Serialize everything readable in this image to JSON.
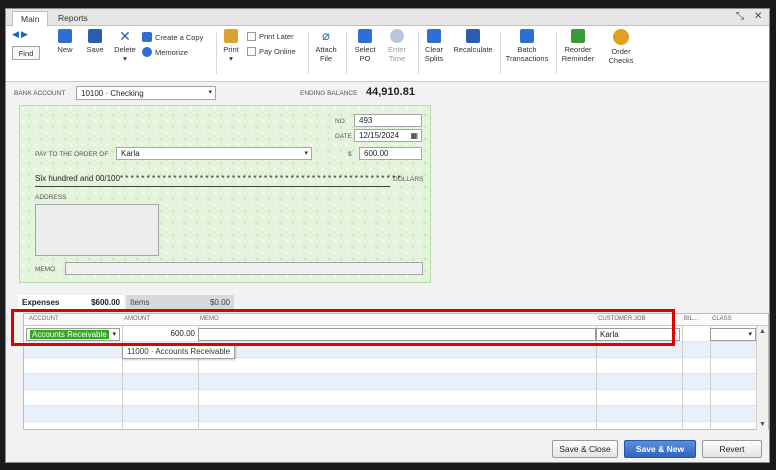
{
  "tabs": {
    "main": "Main",
    "reports": "Reports"
  },
  "window_controls": {
    "restore": "⤡",
    "close": "✕"
  },
  "toolbar": {
    "find": "Find",
    "new": "New",
    "save": "Save",
    "delete": "Delete",
    "create_copy": "Create a Copy",
    "memorize": "Memorize",
    "print": "Print",
    "print_later": "Print Later",
    "pay_online": "Pay Online",
    "attach_file_1": "Attach",
    "attach_file_2": "File",
    "select_po_1": "Select",
    "select_po_2": "PO",
    "enter_time_1": "Enter",
    "enter_time_2": "Time",
    "clear_splits_1": "Clear",
    "clear_splits_2": "Splits",
    "recalculate": "Recalculate",
    "batch_1": "Batch",
    "batch_2": "Transactions",
    "reorder_1": "Reorder",
    "reorder_2": "Reminder",
    "order_checks_1": "Order",
    "order_checks_2": "Checks"
  },
  "bank": {
    "label": "BANK ACCOUNT",
    "value": "10100 · Checking",
    "ending_label": "ENDING BALANCE",
    "ending_value": "44,910.81"
  },
  "check": {
    "no_label": "NO.",
    "no_value": "493",
    "date_label": "DATE",
    "date_value": "12/15/2024",
    "payee_label": "PAY TO THE ORDER OF",
    "payee_value": "Karla",
    "dollar_sign": "$",
    "amount": "600.00",
    "amount_words": "Six hundred and 00/100* * * * * * * * * * * * * * * * * * * * * * * * * * * * * * * * * * * * * * * * * * * * * * * * * * * * *",
    "dollars_label": "DOLLARS",
    "address_label": "ADDRESS",
    "memo_label": "MEMO"
  },
  "detail_tabs": {
    "expenses_label": "Expenses",
    "expenses_amount": "$600.00",
    "items_label": "Items",
    "items_amount": "$0.00"
  },
  "grid": {
    "headers": {
      "account": "ACCOUNT",
      "amount": "AMOUNT",
      "memo": "MEMO",
      "customer_job": "CUSTOMER:JOB",
      "billable": "BIL...",
      "class": "CLASS"
    },
    "row1": {
      "account": "Accounts Receivable",
      "amount": "600.00",
      "customer": "Karla"
    },
    "dropdown_tip": "11000 · Accounts Receivable"
  },
  "footer": {
    "save_close": "Save & Close",
    "save_new": "Save & New",
    "revert": "Revert"
  },
  "colors": {
    "check_bg": "#e4f4dc",
    "highlight": "#e00000",
    "primary_btn": "#2f63bf",
    "account_hl": "#35a61f"
  }
}
